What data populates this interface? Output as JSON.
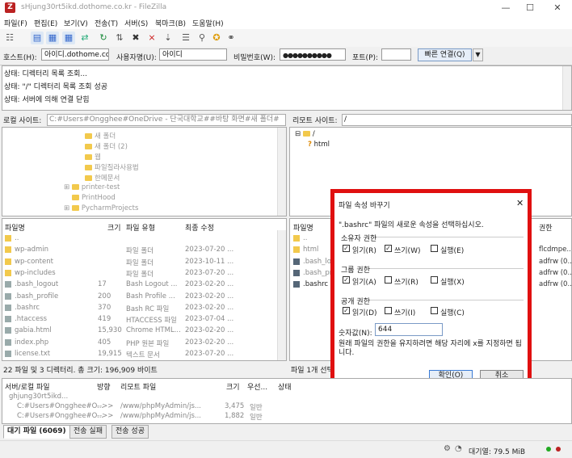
{
  "window": {
    "title": "sHjung30rt5ikd.dothome.co.kr - FileZilla",
    "icon_label": "Z",
    "minimize": "—",
    "maximize": "☐",
    "close": "✕"
  },
  "menu": [
    "파일(F)",
    "편집(E)",
    "보기(V)",
    "전송(T)",
    "서버(S)",
    "북마크(B)",
    "도움말(H)"
  ],
  "quickconnect": {
    "host_label": "호스트(H):",
    "host_value": "아이디.dothome.co.kr",
    "user_label": "사용자명(U):",
    "user_value": "아이디",
    "pass_label": "비밀번호(W):",
    "pass_value": "●●●●●●●●●●",
    "port_label": "포트(P):",
    "port_value": "",
    "connect_button": "빠른 연결(Q)",
    "dropdown": "▼"
  },
  "log": [
    "상태:  디렉터리 목록 조회...",
    "상태:  \"/\" 디렉터리 목록 조회 성공",
    "상태:  서버에 의해 연결 닫힘"
  ],
  "local": {
    "site_label": "로컬 사이트:",
    "site_path": "C:#Users#Ongghee#OneDrive - 단국대학교##바탕 화면#새 폴더#",
    "tree": [
      "새 폴더",
      "새 폴더 (2)",
      "웹",
      "파일질라사용법",
      "한메문서",
      "printer-test",
      "PrintHood",
      "PycharmProjects"
    ],
    "columns": [
      "파일명",
      "크기",
      "파일 유형",
      "최종 수정"
    ],
    "files": [
      {
        "name": "..",
        "size": "",
        "type": "",
        "modified": ""
      },
      {
        "name": "wp-admin",
        "size": "",
        "type": "파일 폴더",
        "modified": "2023-07-20 ..."
      },
      {
        "name": "wp-content",
        "size": "",
        "type": "파일 폴더",
        "modified": "2023-10-11 ..."
      },
      {
        "name": "wp-includes",
        "size": "",
        "type": "파일 폴더",
        "modified": "2023-07-20 ..."
      },
      {
        "name": ".bash_logout",
        "size": "17",
        "type": "Bash Logout ...",
        "modified": "2023-02-20 ..."
      },
      {
        "name": ".bash_profile",
        "size": "200",
        "type": "Bash Profile ...",
        "modified": "2023-02-20 ..."
      },
      {
        "name": ".bashrc",
        "size": "370",
        "type": "Bash RC 파일",
        "modified": "2023-02-20 ..."
      },
      {
        "name": ".htaccess",
        "size": "419",
        "type": "HTACCESS 파일",
        "modified": "2023-07-04 ..."
      },
      {
        "name": "gabia.html",
        "size": "15,930",
        "type": "Chrome HTML...",
        "modified": "2023-02-20 ..."
      },
      {
        "name": "index.php",
        "size": "405",
        "type": "PHP 원본 파일",
        "modified": "2023-02-20 ..."
      },
      {
        "name": "license.txt",
        "size": "19,915",
        "type": "텍스트 문서",
        "modified": "2023-07-20 ..."
      }
    ],
    "status": "22 파일 및 3 디렉터리. 총 크기: 196,909 바이트"
  },
  "remote": {
    "site_label": "리모트 사이트:",
    "site_path": "/",
    "tree": [
      "/",
      "html"
    ],
    "columns": [
      "파일명",
      "권한"
    ],
    "files": [
      {
        "name": "..",
        "perm": ""
      },
      {
        "name": "html",
        "perm": "flcdmpe..."
      },
      {
        "name": ".bash_lo...",
        "perm": "adfrw (0..."
      },
      {
        "name": ".bash_pr...",
        "perm": "adfrw (0..."
      },
      {
        "name": ".bashrc",
        "perm": "adfrw (0..."
      }
    ],
    "status": "파일 1개 선택"
  },
  "dialog": {
    "title": "파일 속성 바꾸기",
    "close": "✕",
    "prompt": "\".bashrc\" 파일의 새로운 속성을 선택하십시오.",
    "owner_label": "소유자 권한",
    "owner": [
      {
        "label": "읽기(R)",
        "checked": true
      },
      {
        "label": "쓰기(W)",
        "checked": true
      },
      {
        "label": "실행(E)",
        "checked": false
      }
    ],
    "group_label": "그룹 권한",
    "group": [
      {
        "label": "읽기(A)",
        "checked": true
      },
      {
        "label": "쓰기(R)",
        "checked": false
      },
      {
        "label": "실행(X)",
        "checked": false
      }
    ],
    "public_label": "공개 권한",
    "public": [
      {
        "label": "읽기(D)",
        "checked": true
      },
      {
        "label": "쓰기(I)",
        "checked": false
      },
      {
        "label": "실행(C)",
        "checked": false
      }
    ],
    "numeric_label": "숫자값(N):",
    "numeric_value": "644",
    "note": "원래 파일의 권한을 유지하려면 해당 자리에 x를 지정하면 됩니다.",
    "ok": "확인(O)",
    "cancel": "취소"
  },
  "queue": {
    "columns": [
      "서버/로컬 파일",
      "방향",
      "리모트 파일",
      "크기",
      "우선...",
      "상태"
    ],
    "rows": [
      {
        "server": "ghjung30rt5ikd...",
        "dir": "",
        "remote": "",
        "size": "",
        "prio": ""
      },
      {
        "server": "C:#Users#Ongghee#O...",
        "dir": "-->>",
        "remote": "/www/phpMyAdmin/js...",
        "size": "3,475",
        "prio": "일반"
      },
      {
        "server": "C:#Users#Ongghee#O...",
        "dir": "-->>",
        "remote": "/www/phpMyAdmin/js...",
        "size": "1,882",
        "prio": "일반"
      }
    ]
  },
  "tabs": [
    "대기 파일 (6069)",
    "전송 실패",
    "전송 성공"
  ],
  "statusbar": {
    "queue": "대기열: 79.5 MiB"
  }
}
